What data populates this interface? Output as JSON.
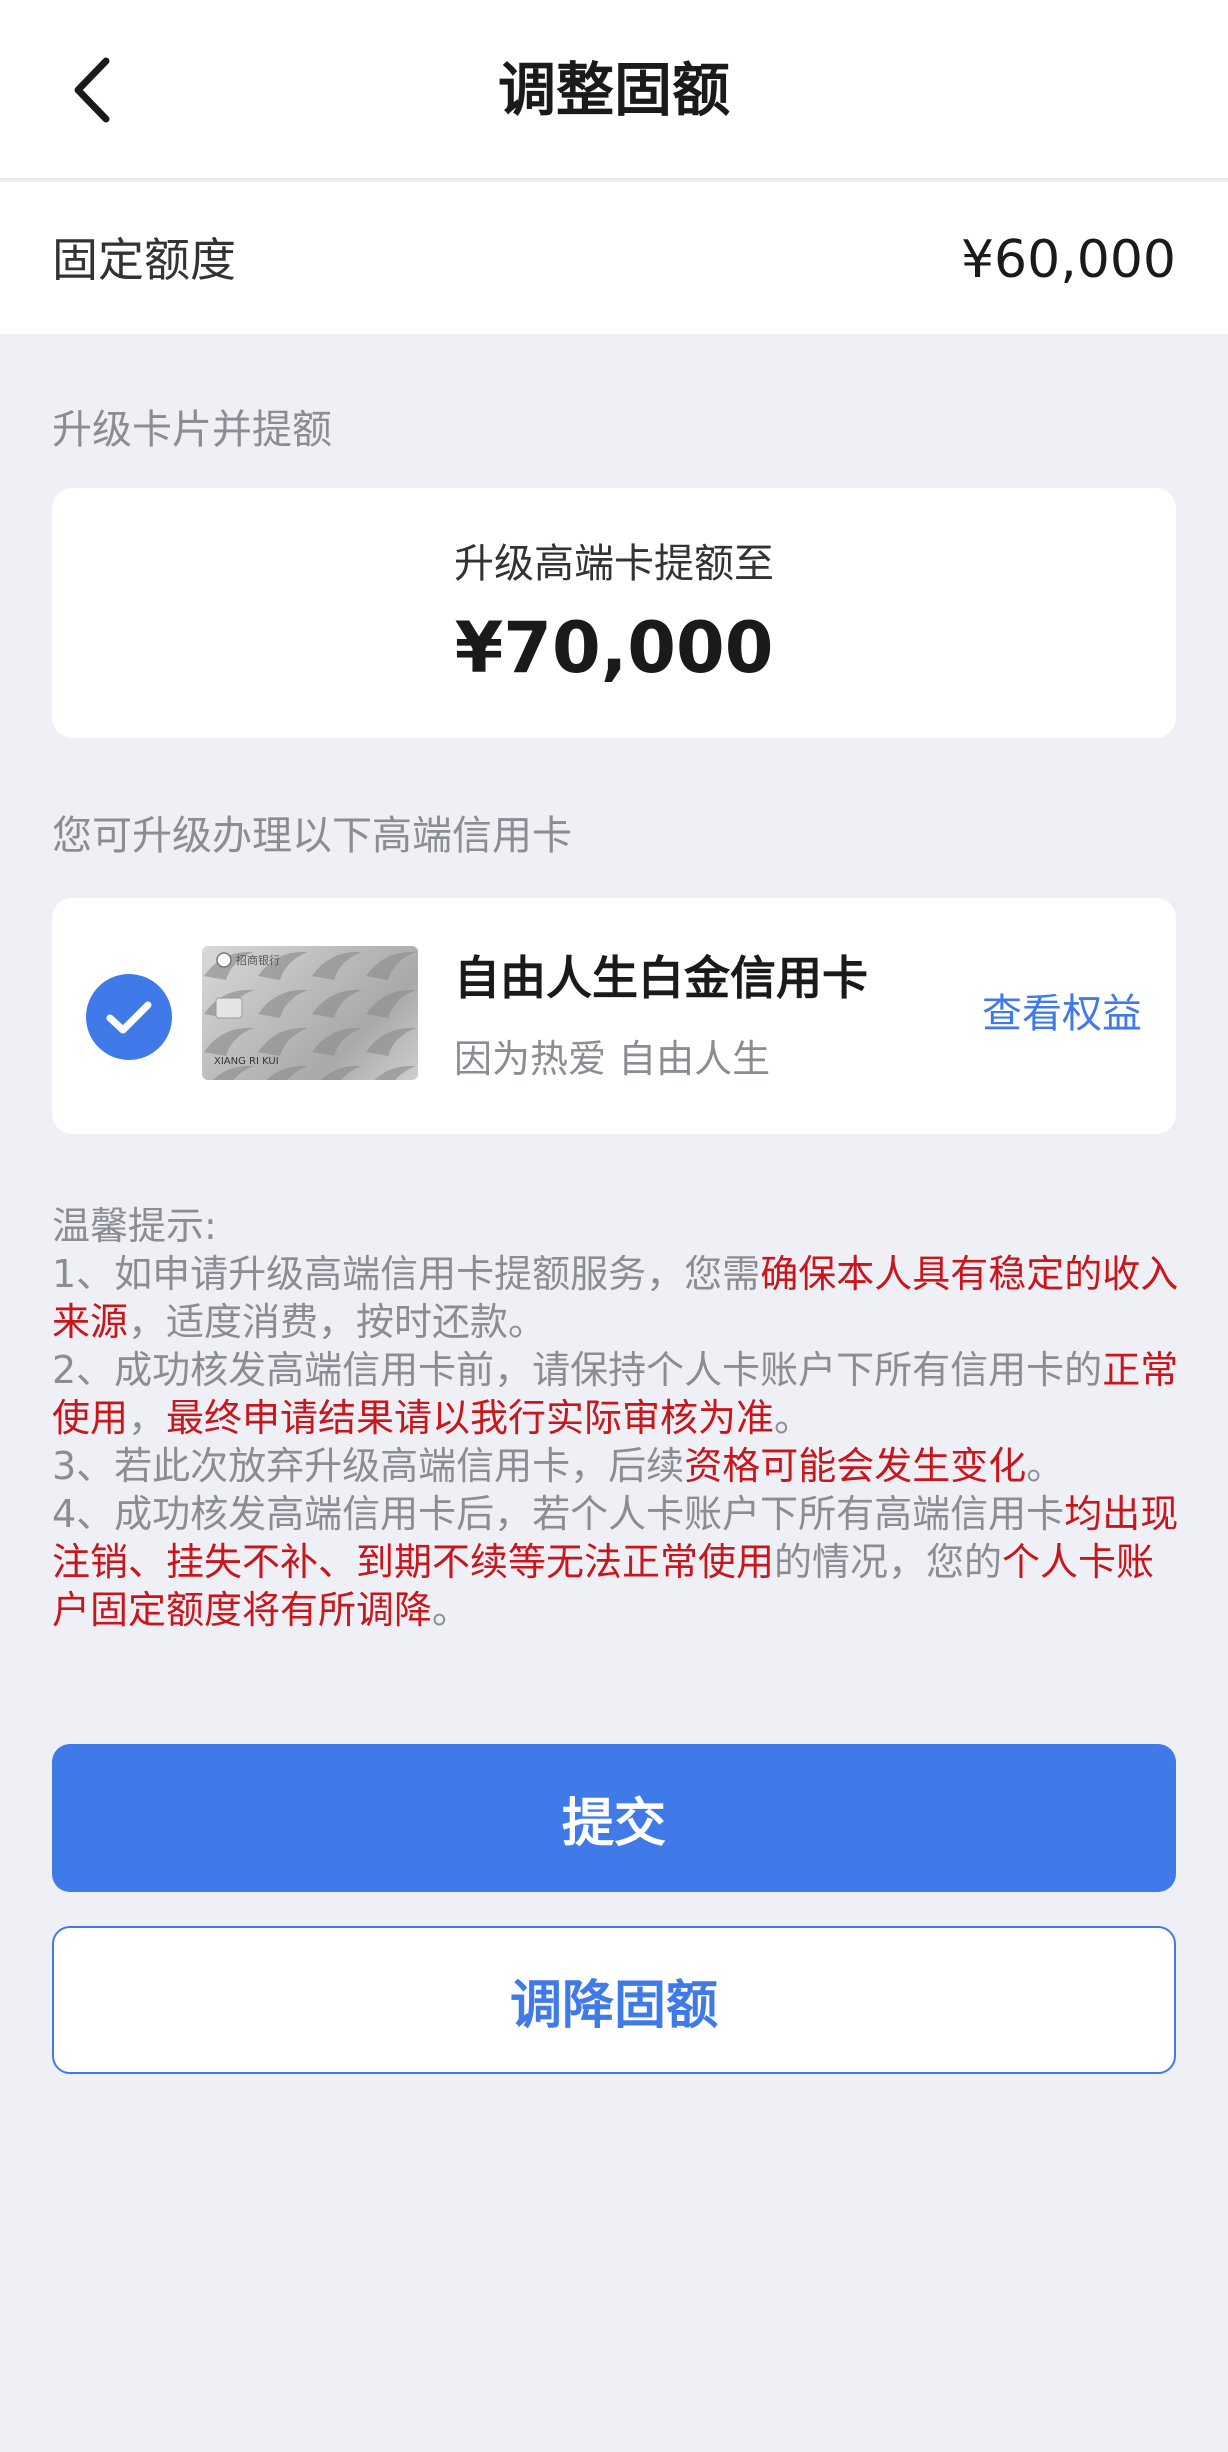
{
  "header": {
    "title": "调整固额",
    "back_icon": "chevron-left-icon"
  },
  "fixed_limit": {
    "label": "固定额度",
    "value": "¥60,000"
  },
  "upgrade_section": {
    "label": "升级卡片并提额",
    "upgrade_text": "升级高端卡提额至",
    "upgrade_amount": "¥70,000"
  },
  "card_section": {
    "label": "您可升级办理以下高端信用卡",
    "card": {
      "checked": true,
      "name": "自由人生白金信用卡",
      "slogan": "因为热爱 自由人生",
      "link": "查看权益",
      "image_caption": "XIANG RI KUI",
      "bank_mark": "招商银行"
    }
  },
  "tips": {
    "title": "温馨提示:",
    "items": [
      [
        {
          "text": "1、如申请升级高端信用卡提额服务，您需",
          "hl": false
        },
        {
          "text": "确保本人具有稳定的收入来源",
          "hl": true
        },
        {
          "text": "，适度消费，按时还款。",
          "hl": false
        }
      ],
      [
        {
          "text": "2、成功核发高端信用卡前，请保持个人卡账户下所有信用卡的",
          "hl": false
        },
        {
          "text": "正常使用",
          "hl": true
        },
        {
          "text": "，",
          "hl": false
        },
        {
          "text": "最终申请结果请以我行实际审核为准",
          "hl": true
        },
        {
          "text": "。",
          "hl": false
        }
      ],
      [
        {
          "text": "3、若此次放弃升级高端信用卡，后续",
          "hl": false
        },
        {
          "text": "资格可能会发生变化",
          "hl": true
        },
        {
          "text": "。",
          "hl": false
        }
      ],
      [
        {
          "text": "4、成功核发高端信用卡后，若个人卡账户下所有高端信用卡",
          "hl": false
        },
        {
          "text": "均出现注销、挂失不补、到期不续等无法正常使用",
          "hl": true
        },
        {
          "text": "的情况，您的",
          "hl": false
        },
        {
          "text": "个人卡账户固定额度将有所调降",
          "hl": true
        },
        {
          "text": "。",
          "hl": false
        }
      ]
    ]
  },
  "buttons": {
    "submit": "提交",
    "reduce": "调降固额"
  },
  "colors": {
    "accent": "#3f7ae8",
    "highlight": "#c8161d",
    "background": "#eef0f5"
  }
}
